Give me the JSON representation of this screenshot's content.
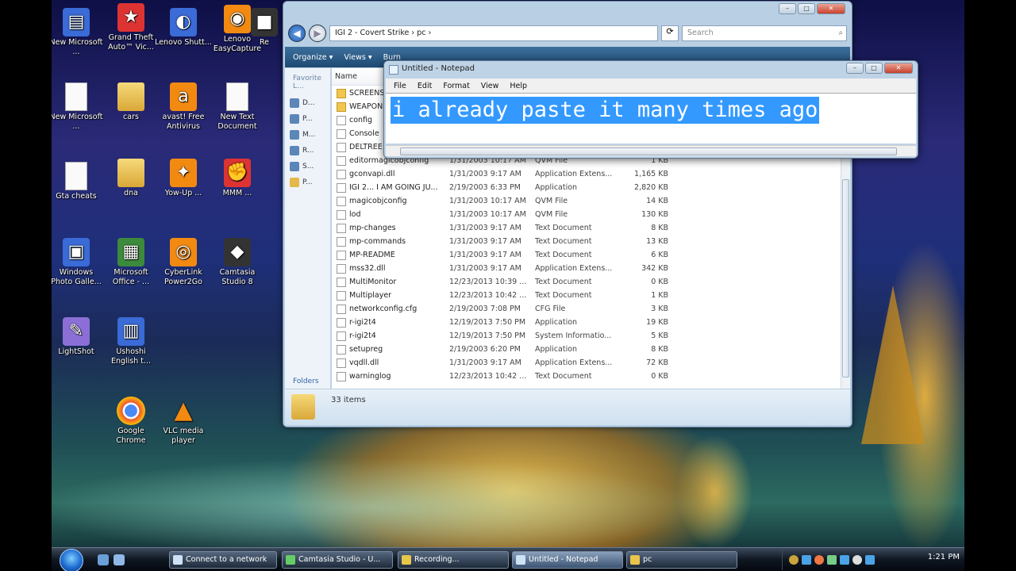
{
  "desktop": {
    "icons": [
      {
        "label": "New Microsoft ...",
        "icon": "wordpad-icon"
      },
      {
        "label": "Grand Theft Auto™ Vic...",
        "icon": "game-icon"
      },
      {
        "label": "Lenovo Shutt...",
        "icon": "lenovo-icon"
      },
      {
        "label": "Lenovo EasyCapture",
        "icon": "camera-icon"
      },
      {
        "label": "Re",
        "icon": "app-icon"
      },
      {
        "label": "New Microsoft ...",
        "icon": "document-icon"
      },
      {
        "label": "cars",
        "icon": "folder-icon"
      },
      {
        "label": "avast! Free Antivirus",
        "icon": "avast-icon"
      },
      {
        "label": "New Text Document",
        "icon": "text-document-icon"
      },
      {
        "label": "Gta cheats",
        "icon": "document-icon"
      },
      {
        "label": "dna",
        "icon": "folder-icon"
      },
      {
        "label": "Yow-Up ...",
        "icon": "app-icon"
      },
      {
        "label": "MMM ...",
        "icon": "app-icon"
      },
      {
        "label": "Windows Photo Galle...",
        "icon": "photo-gallery-icon"
      },
      {
        "label": "Microsoft Office - ...",
        "icon": "office-icon"
      },
      {
        "label": "CyberLink Power2Go",
        "icon": "cyberlink-icon"
      },
      {
        "label": "Camtasia Studio 8",
        "icon": "camtasia-icon"
      },
      {
        "label": "LightShot",
        "icon": "feather-icon"
      },
      {
        "label": "Ushoshi English t...",
        "icon": "book-icon"
      },
      {
        "label": "Google Chrome",
        "icon": "chrome-icon"
      },
      {
        "label": "VLC media player",
        "icon": "vlc-icon"
      }
    ]
  },
  "explorer": {
    "address": "IGI 2 - Covert Strike  ›  pc  ›",
    "search_placeholder": "Search",
    "toolbar": {
      "organize": "Organize ▾",
      "views": "Views ▾",
      "burn": "Burn"
    },
    "nav_header": "Favorite L...",
    "nav_items": [
      "D...",
      "P...",
      "M...",
      "R...",
      "S...",
      "P..."
    ],
    "nav_footer": "Folders",
    "column_name": "Name",
    "files": [
      {
        "name": "SCREENS",
        "date": "",
        "type": "",
        "size": "",
        "kind": "folder"
      },
      {
        "name": "WEAPONS",
        "date": "",
        "type": "",
        "size": "",
        "kind": "folder"
      },
      {
        "name": "config",
        "date": "",
        "type": "",
        "size": "",
        "kind": "file"
      },
      {
        "name": "Console",
        "date": "",
        "type": "",
        "size": "",
        "kind": "file"
      },
      {
        "name": "DELTREE",
        "date": "",
        "type": "",
        "size": "",
        "kind": "file"
      },
      {
        "name": "editormagicobjconfig",
        "date": "1/31/2003 10:17 AM",
        "type": "QVM File",
        "size": "1 KB",
        "kind": "file"
      },
      {
        "name": "gconvapi.dll",
        "date": "1/31/2003 9:17 AM",
        "type": "Application Extens...",
        "size": "1,165 KB",
        "kind": "file"
      },
      {
        "name": "IGI 2... I AM GOING JU...",
        "date": "2/19/2003 6:33 PM",
        "type": "Application",
        "size": "2,820 KB",
        "kind": "file"
      },
      {
        "name": "magicobjconfig",
        "date": "1/31/2003 10:17 AM",
        "type": "QVM File",
        "size": "14 KB",
        "kind": "file"
      },
      {
        "name": "lod",
        "date": "1/31/2003 10:17 AM",
        "type": "QVM File",
        "size": "130 KB",
        "kind": "file"
      },
      {
        "name": "mp-changes",
        "date": "1/31/2003 9:17 AM",
        "type": "Text Document",
        "size": "8 KB",
        "kind": "file"
      },
      {
        "name": "mp-commands",
        "date": "1/31/2003 9:17 AM",
        "type": "Text Document",
        "size": "13 KB",
        "kind": "file"
      },
      {
        "name": "MP-README",
        "date": "1/31/2003 9:17 AM",
        "type": "Text Document",
        "size": "6 KB",
        "kind": "file"
      },
      {
        "name": "mss32.dll",
        "date": "1/31/2003 9:17 AM",
        "type": "Application Extens...",
        "size": "342 KB",
        "kind": "file"
      },
      {
        "name": "MultiMonitor",
        "date": "12/23/2013 10:39 ...",
        "type": "Text Document",
        "size": "0 KB",
        "kind": "file"
      },
      {
        "name": "Multiplayer",
        "date": "12/23/2013 10:42 ...",
        "type": "Text Document",
        "size": "1 KB",
        "kind": "file"
      },
      {
        "name": "networkconfig.cfg",
        "date": "2/19/2003 7:08 PM",
        "type": "CFG File",
        "size": "3 KB",
        "kind": "file"
      },
      {
        "name": "r-igi2t4",
        "date": "12/19/2013 7:50 PM",
        "type": "Application",
        "size": "19 KB",
        "kind": "file"
      },
      {
        "name": "r-igi2t4",
        "date": "12/19/2013 7:50 PM",
        "type": "System Informatio...",
        "size": "5 KB",
        "kind": "file"
      },
      {
        "name": "setupreg",
        "date": "2/19/2003 6:20 PM",
        "type": "Application",
        "size": "8 KB",
        "kind": "file"
      },
      {
        "name": "vqdll.dll",
        "date": "1/31/2003 9:17 AM",
        "type": "Application Extens...",
        "size": "72 KB",
        "kind": "file"
      },
      {
        "name": "warninglog",
        "date": "12/23/2013 10:42 ...",
        "type": "Text Document",
        "size": "0 KB",
        "kind": "file"
      }
    ],
    "item_count": "33 items"
  },
  "notepad": {
    "title": "Untitled - Notepad",
    "menu": [
      "File",
      "Edit",
      "Format",
      "View",
      "Help"
    ],
    "text": "i already  paste it many times ago"
  },
  "taskbar": {
    "buttons": [
      {
        "label": "Connect to a network",
        "active": false
      },
      {
        "label": "Camtasia Studio - U...",
        "active": false
      },
      {
        "label": "Recording...",
        "active": false
      },
      {
        "label": "Untitled - Notepad",
        "active": true
      },
      {
        "label": "pc",
        "active": false
      }
    ],
    "clock": "1:21 PM"
  }
}
